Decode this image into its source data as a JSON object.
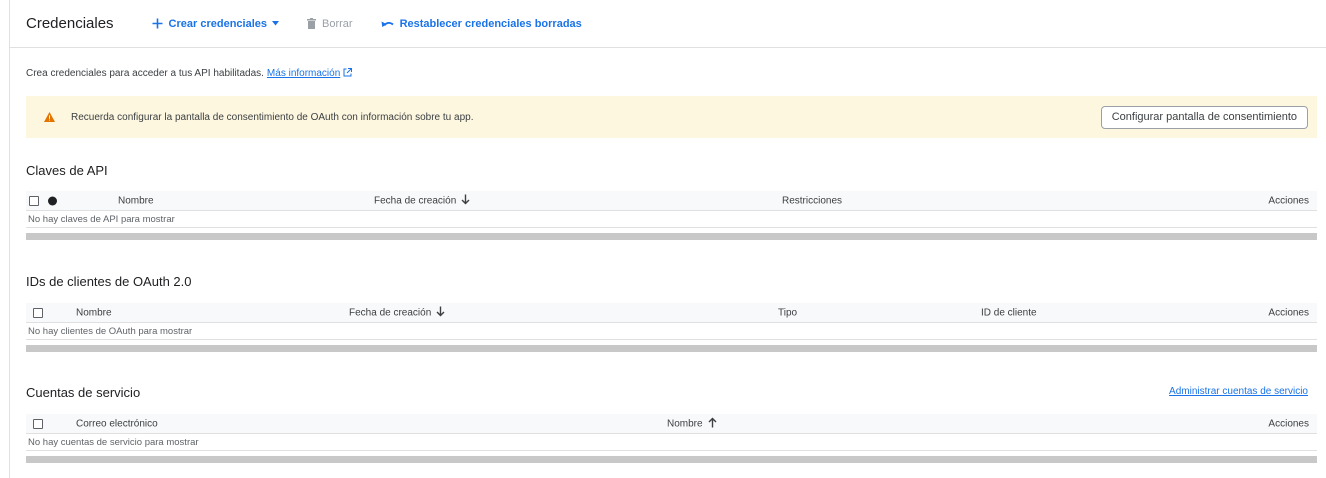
{
  "toolbar": {
    "title": "Credenciales",
    "create_label": "Crear credenciales",
    "delete_label": "Borrar",
    "restore_label": "Restablecer credenciales borradas"
  },
  "intro": {
    "text": "Crea credenciales para acceder a tus API habilitadas.",
    "link_label": "Más información"
  },
  "banner": {
    "message": "Recuerda configurar la pantalla de consentimiento de OAuth con información sobre tu app.",
    "button_label": "Configurar pantalla de consentimiento"
  },
  "api_keys": {
    "title": "Claves de API",
    "columns": [
      "Nombre",
      "Fecha de creación",
      "Restricciones",
      "Acciones"
    ],
    "empty": "No hay claves de API para mostrar"
  },
  "oauth": {
    "title": "IDs de clientes de OAuth 2.0",
    "columns": [
      "Nombre",
      "Fecha de creación",
      "Tipo",
      "ID de cliente",
      "Acciones"
    ],
    "empty": "No hay clientes de OAuth para mostrar"
  },
  "service_accounts": {
    "title": "Cuentas de servicio",
    "manage_link": "Administrar cuentas de servicio",
    "columns": [
      "Correo electrónico",
      "Nombre",
      "Acciones"
    ],
    "empty": "No hay cuentas de servicio para mostrar"
  },
  "colors": {
    "accent": "#1a73e8",
    "warning": "#e37400",
    "banner_bg": "#fef7e0"
  },
  "icons": {
    "create": "plus-icon",
    "dropdown": "caret-down-icon",
    "delete": "trash-icon",
    "restore": "undo-icon",
    "external": "external-link-icon",
    "warning": "warning-triangle-icon",
    "sort_desc": "arrow-down-icon",
    "sort_asc": "arrow-up-icon"
  }
}
